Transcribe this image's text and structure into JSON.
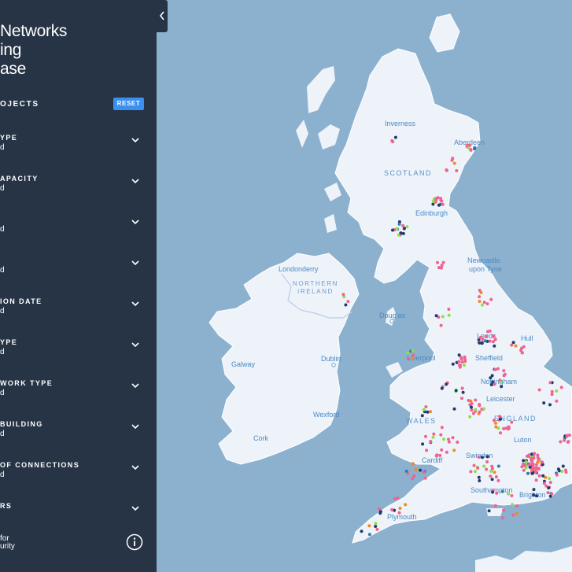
{
  "app": {
    "title_lines": [
      "Networks",
      "ing",
      "ase"
    ]
  },
  "filters": {
    "header": "OJECTS",
    "reset_label": "RESET",
    "items": [
      {
        "label": "YPE",
        "value": "d"
      },
      {
        "label": "APACITY",
        "value": "d"
      },
      {
        "label": "",
        "value": "d"
      },
      {
        "label": "",
        "value": "d"
      },
      {
        "label": "ION DATE",
        "value": "d"
      },
      {
        "label": "YPE",
        "value": "d"
      },
      {
        "label": "WORK TYPE",
        "value": "d"
      },
      {
        "label": "BUILDING",
        "value": "d"
      },
      {
        "label": "OF CONNECTIONS",
        "value": "d"
      },
      {
        "label": "RS",
        "value": ""
      }
    ]
  },
  "footer": {
    "logo_lines": [
      "for",
      "urity"
    ],
    "info_icon": "info-icon"
  },
  "map": {
    "places": [
      {
        "id": "inverness",
        "name": "Inverness"
      },
      {
        "id": "aberdeen",
        "name": "Aberdeen"
      },
      {
        "id": "scotland",
        "name": "SCOTLAND"
      },
      {
        "id": "edinburgh",
        "name": "Edinburgh"
      },
      {
        "id": "londonderry",
        "name": "Londonderry"
      },
      {
        "id": "northern_ireland_1",
        "name": "NORTHERN"
      },
      {
        "id": "northern_ireland_2",
        "name": "IRELAND"
      },
      {
        "id": "newcastle_1",
        "name": "Newcastle"
      },
      {
        "id": "newcastle_2",
        "name": "upon Tyne"
      },
      {
        "id": "douglas",
        "name": "Douglas"
      },
      {
        "id": "leeds",
        "name": "Leeds"
      },
      {
        "id": "hull",
        "name": "Hull"
      },
      {
        "id": "dublin",
        "name": "Dublin"
      },
      {
        "id": "galway",
        "name": "Galway"
      },
      {
        "id": "liverpool",
        "name": "Liverpool"
      },
      {
        "id": "sheffield",
        "name": "Sheffield"
      },
      {
        "id": "nottingham",
        "name": "Nottingham"
      },
      {
        "id": "leicester",
        "name": "Leicester"
      },
      {
        "id": "wexford",
        "name": "Wexford"
      },
      {
        "id": "wales",
        "name": "WALES"
      },
      {
        "id": "england",
        "name": "ENGLAND"
      },
      {
        "id": "cork",
        "name": "Cork"
      },
      {
        "id": "luton",
        "name": "Luton"
      },
      {
        "id": "cardiff",
        "name": "Cardiff"
      },
      {
        "id": "swindon",
        "name": "Swindon"
      },
      {
        "id": "southampton",
        "name": "Southampton"
      },
      {
        "id": "brighton",
        "name": "Brighton"
      },
      {
        "id": "plymouth",
        "name": "Plymouth"
      }
    ],
    "marker_colors": {
      "pink": "#f06292",
      "navy": "#1f3c6e",
      "green": "#8ee04a",
      "orange": "#f08a24",
      "teal": "#2a7fa8"
    },
    "colors": {
      "sea": "#8cb1cf",
      "land": "#eef3fa",
      "sidebar": "#263445",
      "accent": "#3b8ff0"
    }
  }
}
